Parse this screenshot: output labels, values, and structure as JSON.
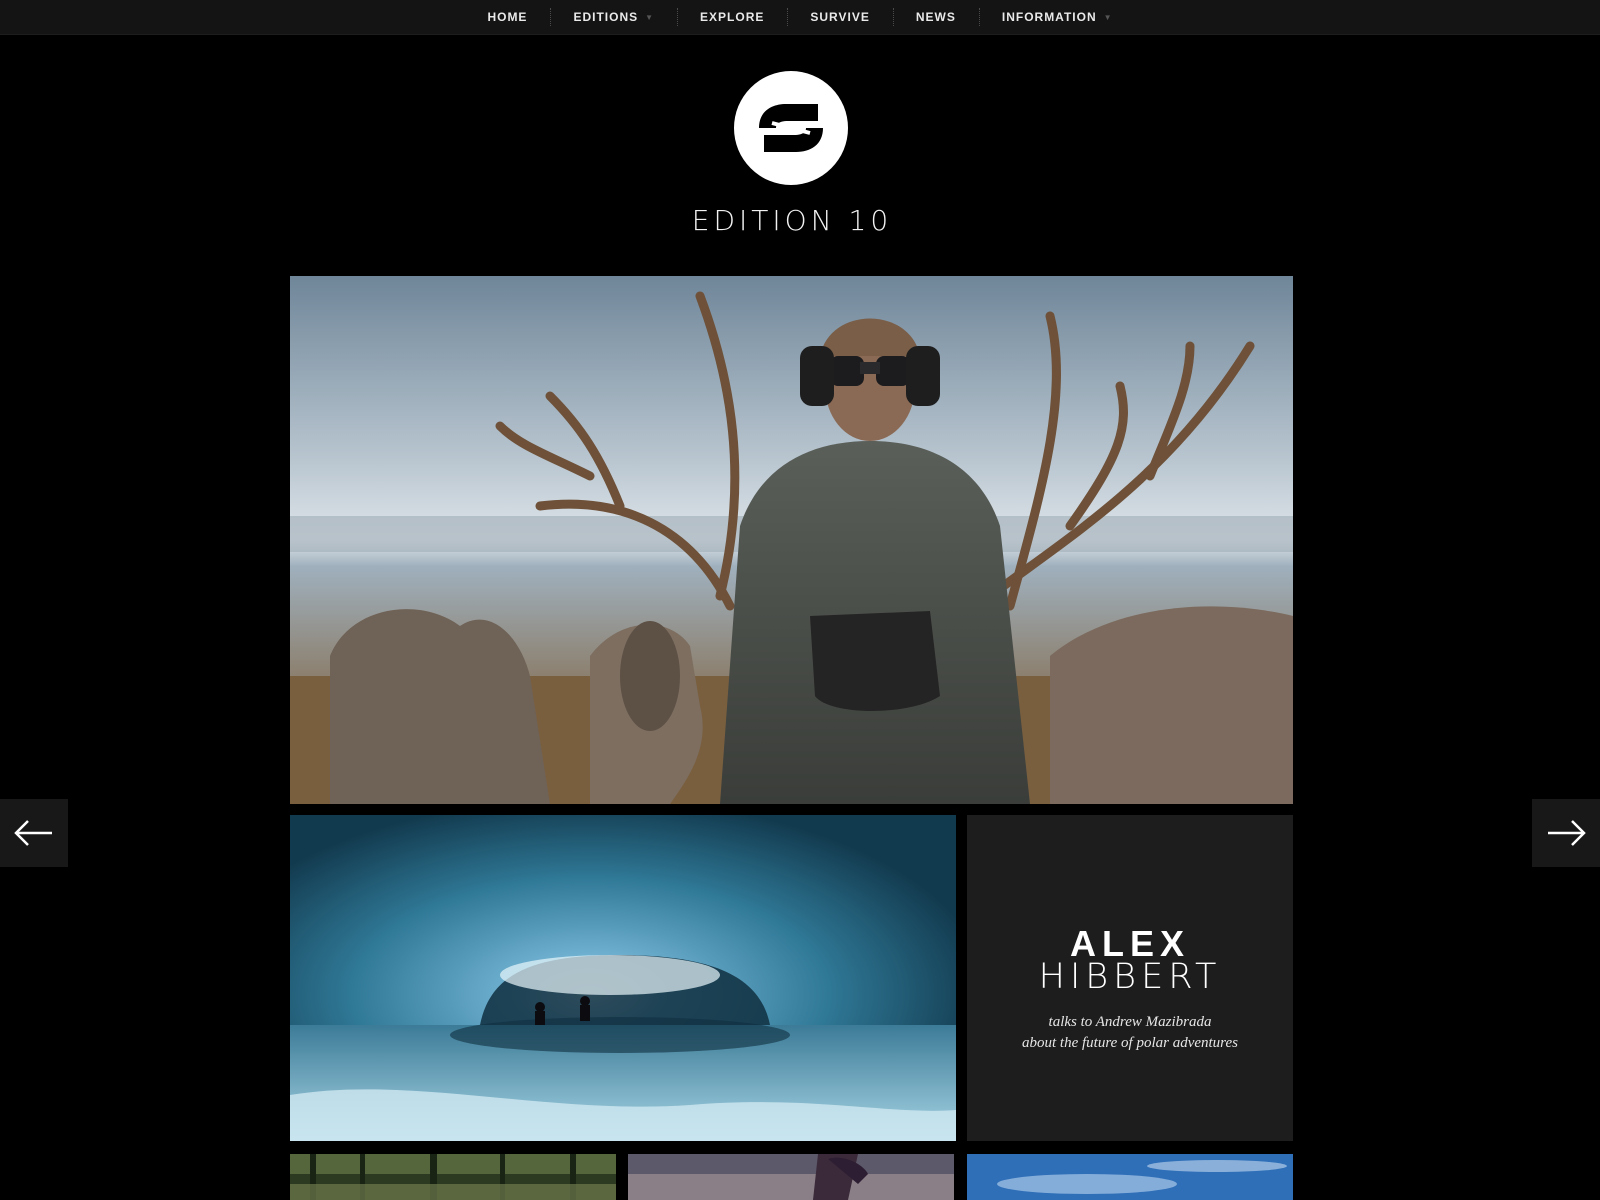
{
  "nav": {
    "items": [
      {
        "label": "HOME",
        "has_dropdown": false
      },
      {
        "label": "EDITIONS",
        "has_dropdown": true
      },
      {
        "label": "EXPLORE",
        "has_dropdown": false
      },
      {
        "label": "SURVIVE",
        "has_dropdown": false
      },
      {
        "label": "NEWS",
        "has_dropdown": false
      },
      {
        "label": "INFORMATION",
        "has_dropdown": true
      }
    ],
    "caret": "▼"
  },
  "header": {
    "edition_title": "EDITION 10"
  },
  "feature": {
    "name_first": "ALEX",
    "name_last": "HIBBERT",
    "subtitle_line1": "talks to Andrew Mazibrada",
    "subtitle_line2": "about the future of polar adventures"
  },
  "icons": {
    "prev": "arrow-left-icon",
    "next": "arrow-right-icon",
    "logo": "circular-s-logo"
  },
  "colors": {
    "background": "#000000",
    "nav_background": "#141414",
    "text_tile_background": "#1d1d1d",
    "text": "#ffffff"
  }
}
